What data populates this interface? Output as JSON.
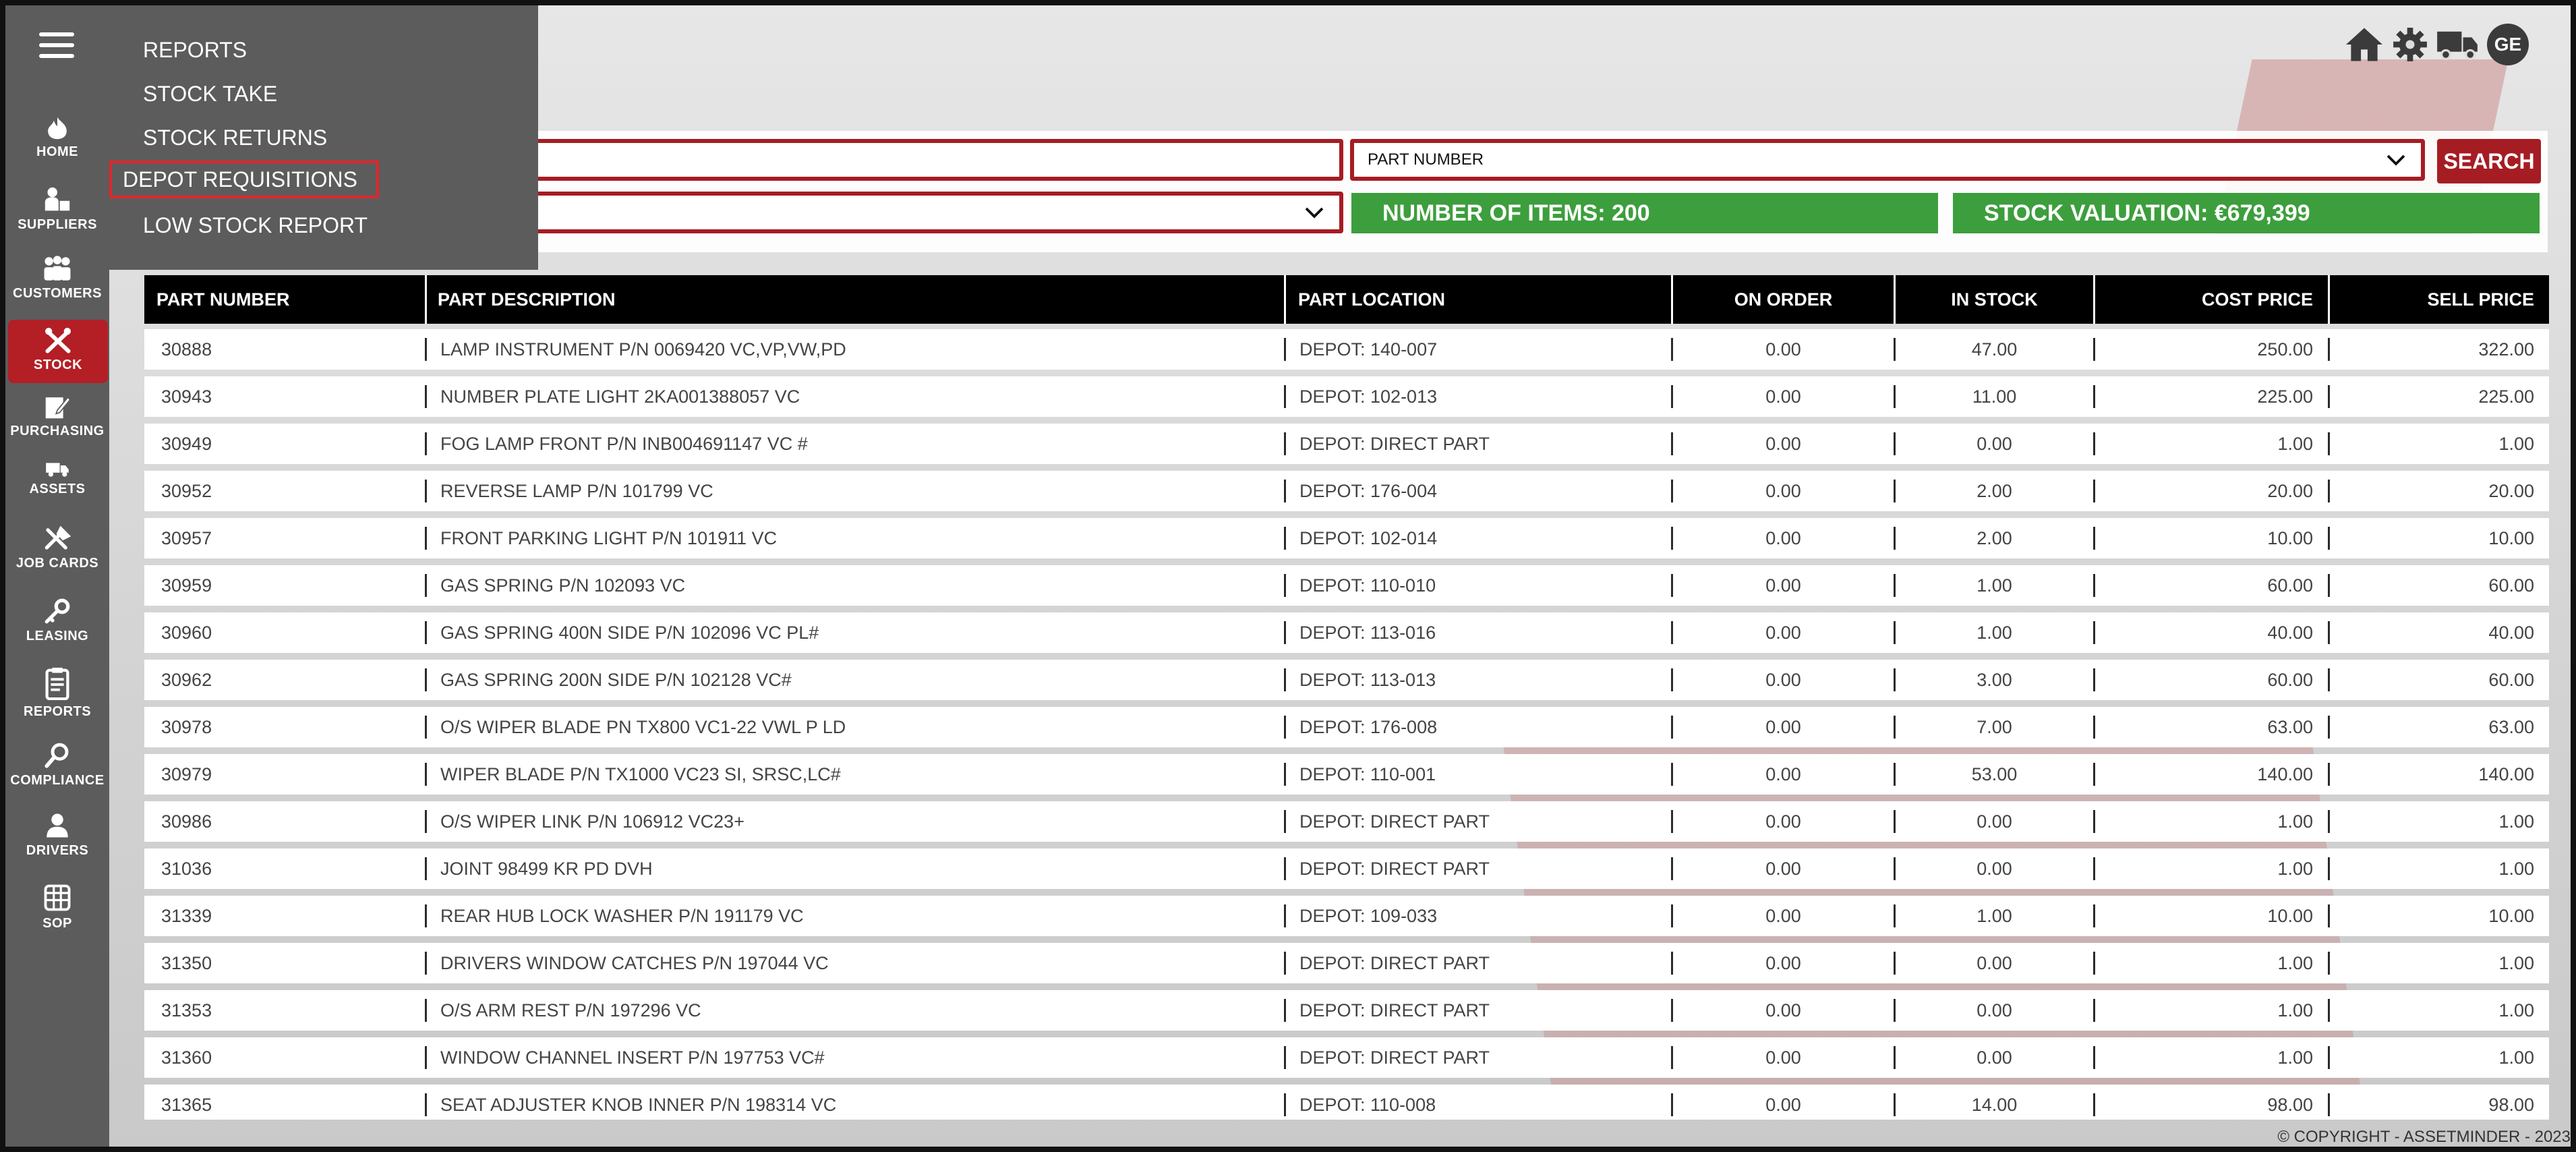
{
  "sidebar": {
    "items": [
      {
        "label": "HOME",
        "icon": "home-icon"
      },
      {
        "label": "SUPPLIERS",
        "icon": "suppliers-icon"
      },
      {
        "label": "CUSTOMERS",
        "icon": "customers-icon"
      },
      {
        "label": "STOCK",
        "icon": "stock-icon",
        "active": true
      },
      {
        "label": "PURCHASING",
        "icon": "purchasing-icon"
      },
      {
        "label": "ASSETS",
        "icon": "truck-icon"
      },
      {
        "label": "JOB CARDS",
        "icon": "tools-icon"
      },
      {
        "label": "LEASING",
        "icon": "key-icon"
      },
      {
        "label": "REPORTS",
        "icon": "clipboard-icon"
      },
      {
        "label": "COMPLIANCE",
        "icon": "magnifier-icon"
      },
      {
        "label": "DRIVERS",
        "icon": "driver-icon"
      },
      {
        "label": "SOP",
        "icon": "sop-icon"
      }
    ]
  },
  "menu": {
    "items": [
      "REPORTS",
      "STOCK TAKE",
      "STOCK RETURNS",
      "DEPOT REQUISITIONS",
      "LOW STOCK REPORT"
    ],
    "highlighted": "DEPOT REQUISITIONS"
  },
  "header": {
    "user_initials": "GE",
    "icons": [
      "home-icon",
      "gear-icon",
      "truck-icon"
    ]
  },
  "filters": {
    "search_value": "",
    "field_select": "PART NUMBER",
    "depot_select": "",
    "search_label": "SEARCH",
    "items_count": "NUMBER OF ITEMS: 200",
    "stock_valuation": "STOCK VALUATION: €679,399"
  },
  "table": {
    "columns": [
      "PART NUMBER",
      "PART DESCRIPTION",
      "PART LOCATION",
      "ON ORDER",
      "IN STOCK",
      "COST PRICE",
      "SELL PRICE"
    ],
    "rows": [
      [
        "30888",
        "LAMP INSTRUMENT P/N 0069420 VC,VP,VW,PD",
        "DEPOT: 140-007",
        "0.00",
        "47.00",
        "250.00",
        "322.00"
      ],
      [
        "30943",
        "NUMBER PLATE LIGHT 2KA001388057 VC",
        "DEPOT: 102-013",
        "0.00",
        "11.00",
        "225.00",
        "225.00"
      ],
      [
        "30949",
        "FOG LAMP FRONT P/N INB004691147 VC #",
        "DEPOT: DIRECT PART",
        "0.00",
        "0.00",
        "1.00",
        "1.00"
      ],
      [
        "30952",
        "REVERSE LAMP P/N 101799 VC",
        "DEPOT: 176-004",
        "0.00",
        "2.00",
        "20.00",
        "20.00"
      ],
      [
        "30957",
        "FRONT PARKING LIGHT P/N 101911 VC",
        "DEPOT: 102-014",
        "0.00",
        "2.00",
        "10.00",
        "10.00"
      ],
      [
        "30959",
        "GAS SPRING P/N 102093 VC",
        "DEPOT: 110-010",
        "0.00",
        "1.00",
        "60.00",
        "60.00"
      ],
      [
        "30960",
        "GAS SPRING 400N SIDE P/N 102096 VC PL#",
        "DEPOT: 113-016",
        "0.00",
        "1.00",
        "40.00",
        "40.00"
      ],
      [
        "30962",
        "GAS SPRING 200N SIDE P/N 102128 VC#",
        "DEPOT: 113-013",
        "0.00",
        "3.00",
        "60.00",
        "60.00"
      ],
      [
        "30978",
        "O/S WIPER BLADE PN TX800 VC1-22 VWL P LD",
        "DEPOT: 176-008",
        "0.00",
        "7.00",
        "63.00",
        "63.00"
      ],
      [
        "30979",
        "WIPER BLADE P/N TX1000 VC23 SI, SRSC,LC#",
        "DEPOT: 110-001",
        "0.00",
        "53.00",
        "140.00",
        "140.00"
      ],
      [
        "30986",
        "O/S WIPER LINK P/N 106912 VC23+",
        "DEPOT: DIRECT PART",
        "0.00",
        "0.00",
        "1.00",
        "1.00"
      ],
      [
        "31036",
        "JOINT 98499 KR PD DVH",
        "DEPOT: DIRECT PART",
        "0.00",
        "0.00",
        "1.00",
        "1.00"
      ],
      [
        "31339",
        "REAR HUB LOCK WASHER P/N 191179 VC",
        "DEPOT: 109-033",
        "0.00",
        "1.00",
        "10.00",
        "10.00"
      ],
      [
        "31350",
        "DRIVERS WINDOW CATCHES P/N 197044 VC",
        "DEPOT: DIRECT PART",
        "0.00",
        "0.00",
        "1.00",
        "1.00"
      ],
      [
        "31353",
        "O/S ARM REST P/N 197296 VC",
        "DEPOT: DIRECT PART",
        "0.00",
        "0.00",
        "1.00",
        "1.00"
      ],
      [
        "31360",
        "WINDOW CHANNEL INSERT P/N 197753 VC#",
        "DEPOT: DIRECT PART",
        "0.00",
        "0.00",
        "1.00",
        "1.00"
      ],
      [
        "31365",
        "SEAT ADJUSTER KNOB INNER P/N 198314 VC",
        "DEPOT: 110-008",
        "0.00",
        "14.00",
        "98.00",
        "98.00"
      ]
    ]
  },
  "footer": {
    "copyright": "© COPYRIGHT - ASSETMINDER - 2023"
  },
  "colors": {
    "sidebar": "#5c5c5c",
    "accent_red": "#a51d23",
    "active_red": "#b31f25",
    "stat_green": "#3d9e3d",
    "header_black": "#000000"
  }
}
